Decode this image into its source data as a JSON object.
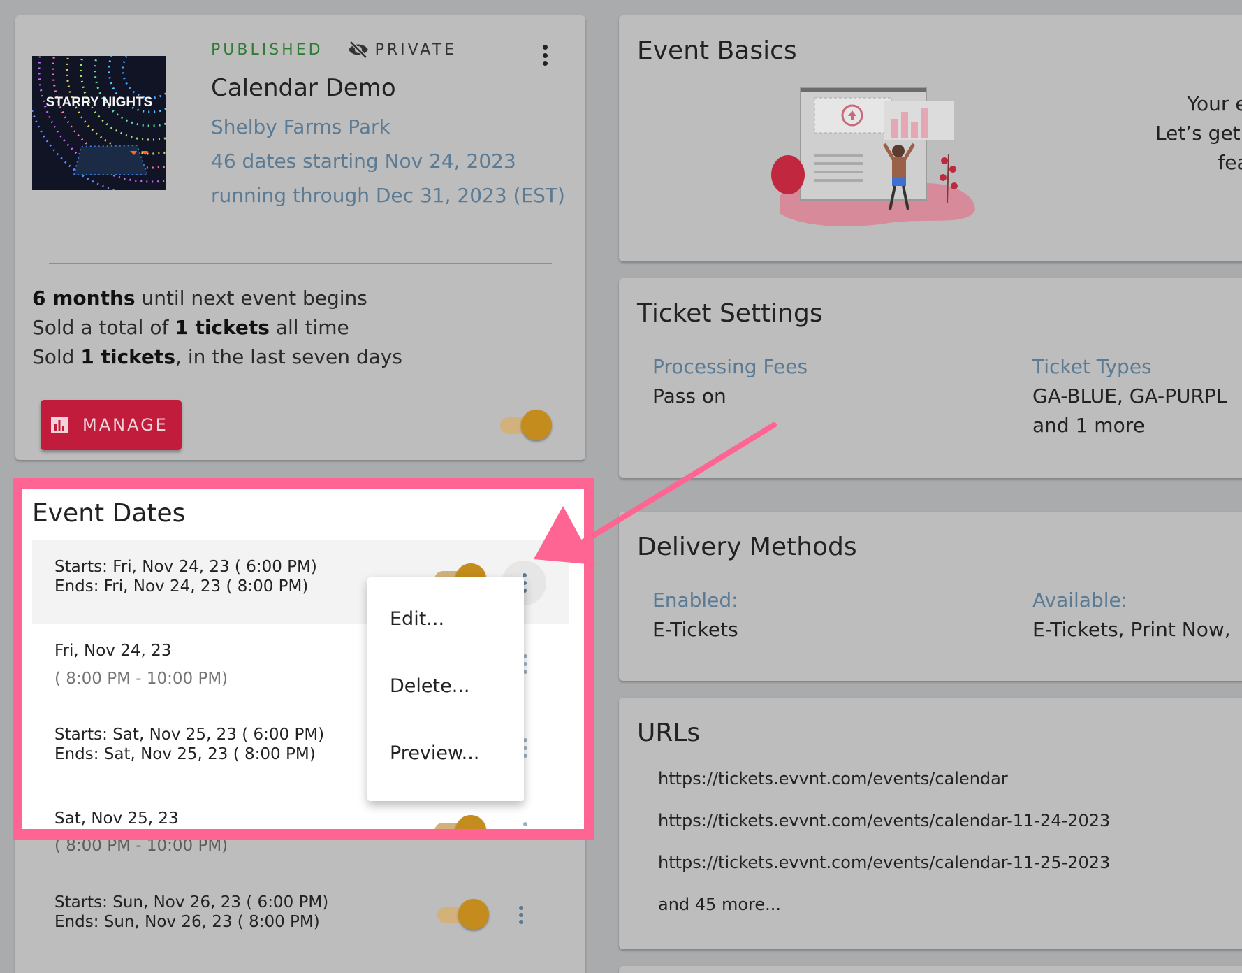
{
  "summary": {
    "status_published": "PUBLISHED",
    "status_private": "PRIVATE",
    "thumbnail_text": "STARRY NIGHTS",
    "title": "Calendar Demo",
    "venue": "Shelby Farms Park",
    "dates_line": "46 dates starting Nov 24, 2023",
    "through_line": "running through Dec 31, 2023 (EST)",
    "stat1_bold": "6 months",
    "stat1_rest": " until next event begins",
    "stat2_pre": "Sold a total of ",
    "stat2_bold": "1 tickets",
    "stat2_rest": " all time",
    "stat3_pre": "Sold ",
    "stat3_bold": "1 tickets",
    "stat3_rest": ", in the last seven days",
    "manage_label": "MANAGE"
  },
  "basics": {
    "title": "Event Basics",
    "msg_line1": "Your event is n",
    "msg_line2": "Let’s get one uplo",
    "msg_line3": "featured on"
  },
  "tickets": {
    "title": "Ticket Settings",
    "fees_label": "Processing Fees",
    "fees_value": "Pass on",
    "types_label": "Ticket Types",
    "types_value1": "GA-BLUE, GA-PURPL",
    "types_value2": "and 1 more"
  },
  "delivery": {
    "title": "Delivery Methods",
    "enabled_label": "Enabled:",
    "enabled_value": "E-Tickets",
    "available_label": "Available:",
    "available_value": "E-Tickets, Print Now,"
  },
  "urls": {
    "title": "URLs",
    "items": [
      "https://tickets.evvnt.com/events/calendar",
      "https://tickets.evvnt.com/events/calendar-11-24-2023",
      "https://tickets.evvnt.com/events/calendar-11-25-2023",
      "and 45 more..."
    ]
  },
  "dates": {
    "title": "Event Dates",
    "rows": [
      {
        "line1": "Starts: Fri, Nov 24, 23 ( 6:00 PM)",
        "line2": "Ends: Fri, Nov 24, 23 ( 8:00 PM)"
      },
      {
        "line1": "Fri, Nov 24, 23",
        "line2": "( 8:00 PM - 10:00 PM)"
      },
      {
        "line1": "Starts: Sat, Nov 25, 23 ( 6:00 PM)",
        "line2": "Ends: Sat, Nov 25, 23 ( 8:00 PM)"
      },
      {
        "line1": "Sat, Nov 25, 23",
        "line2": "( 8:00 PM - 10:00 PM)"
      },
      {
        "line1": "Starts: Sun, Nov 26, 23 ( 6:00 PM)",
        "line2": "Ends: Sun, Nov 26, 23 ( 8:00 PM)"
      }
    ]
  },
  "menu": {
    "edit": "Edit...",
    "delete": "Delete...",
    "preview": "Preview..."
  },
  "colors": {
    "highlight": "#fe6592",
    "manage_button": "#c11c3b",
    "toggle_knob": "#c48b1d",
    "published": "#2f7d32",
    "link_text": "#5b7b95"
  },
  "icons": [
    "eye-off-icon",
    "more-vert-icon",
    "bar-chart-icon",
    "annotation-arrow"
  ]
}
